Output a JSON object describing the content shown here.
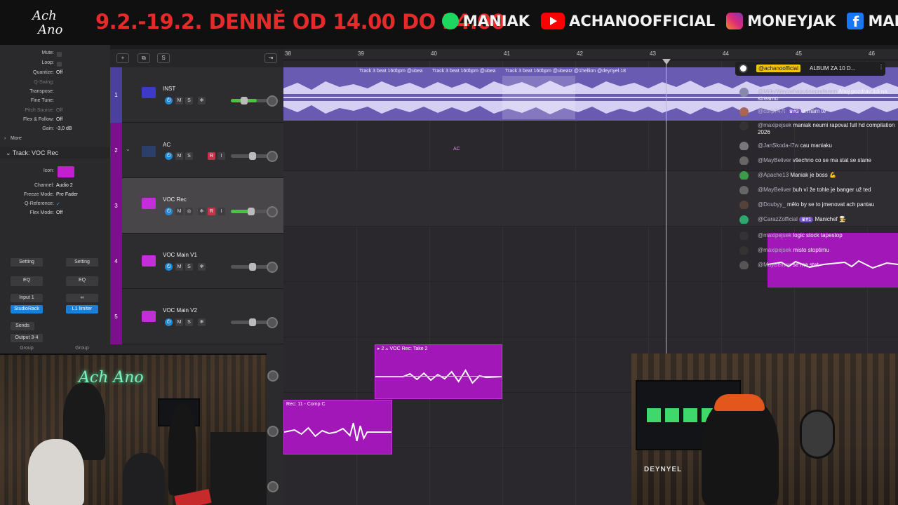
{
  "banner": {
    "logo_text": "ACH ANO",
    "promo_text": "9.2.-19.2. DENNĚ OD 14.00 DO 24.00",
    "socials": [
      {
        "icon": "spotify-icon",
        "label": "MANIAK"
      },
      {
        "icon": "youtube-icon",
        "label": "ACHANOOFFICIAL"
      },
      {
        "icon": "instagram-icon",
        "label": "MONEYJAK"
      },
      {
        "icon": "facebook-icon",
        "label": "MANIAKNAME"
      }
    ]
  },
  "inspector": {
    "mute_label": "Mute:",
    "loop_label": "Loop:",
    "quantize_label": "Quantize:",
    "quantize_value": "Off",
    "qswing_label": "Q-Swing:",
    "transpose_label": "Transpose:",
    "finetune_label": "Fine Tune:",
    "pitchsource_label": "Pitch Source:",
    "pitchsource_value": "Off",
    "flexfollow_label": "Flex & Follow:",
    "flexfollow_value": "Off",
    "gain_label": "Gain:",
    "gain_value": "-3,0 dB",
    "more_label": "More",
    "track_header": "Track:  VOC Rec",
    "icon_label": "Icon:",
    "channel_label": "Channel:",
    "channel_value": "Audio 2",
    "freeze_label": "Freeze Mode:",
    "freeze_value": "Pre Fader",
    "qref_label": "Q-Reference:",
    "qref_value": "✓",
    "flexmode_label": "Flex Mode:",
    "flexmode_value": "Off",
    "setting_left": "Setting",
    "setting_right": "Setting",
    "eq_left": "EQ",
    "eq_right": "EQ",
    "input_label": "Input 1",
    "plugin_left": "StudioRack",
    "plugin_right": "L1 limiter",
    "sends_label": "Sends",
    "output_label": "Output 3-4",
    "group_left": "Group",
    "group_right": "Group"
  },
  "toolbar": {
    "add": "+",
    "dup": "⧉",
    "s": "S"
  },
  "tracks": [
    {
      "num": "1",
      "name": "INST"
    },
    {
      "num": "2",
      "name": "AC"
    },
    {
      "num": "3",
      "name": "VOC Rec"
    },
    {
      "num": "4",
      "name": "VOC Main V1"
    },
    {
      "num": "5",
      "name": "VOC Main V2"
    }
  ],
  "button_labels": {
    "mute": "M",
    "solo": "S",
    "record": "R",
    "input": "I"
  },
  "ruler": {
    "bars": [
      "38",
      "39",
      "40",
      "41",
      "42",
      "43",
      "44",
      "45",
      "46"
    ]
  },
  "regions": {
    "inst_1": "Track 3 beat 160bpm @ubea",
    "inst_2": "Track 3 beat 160bpm @ubea",
    "inst_3": "Track 3 beat 160bpm @ubeatz @1hellion @deynyel.18",
    "ac_label": "AC",
    "voc_take": "▸ 2  ⟑ VOC Rec: Take 2",
    "voc_comp": "Rec: 11 - Comp C"
  },
  "chat": {
    "pinned_name": "@achanoofficial",
    "pinned_msg": "ALBUM ZA 10 D...",
    "lines": [
      {
        "name": "@MilkyWayzehaputinepreferem",
        "msg": "Ahoj pozdrav lidi na streamu"
      },
      {
        "name": "@corp747t",
        "badge": "#3",
        "msg": "a mam te"
      },
      {
        "name": "@maxipejsek",
        "msg": "maniak neumi rapovat full hd compilation 2026"
      },
      {
        "name": "@JanSkoda-l7w",
        "msg": "cau maniaku"
      },
      {
        "name": "@MayBeliver",
        "msg": "všechno co se ma stat se stane"
      },
      {
        "name": "@Apache13",
        "msg": "Maniak je boss 💪"
      },
      {
        "name": "@MayBeliver",
        "msg": "buh ví že tohle je banger už ted"
      },
      {
        "name": "@Doubyy_",
        "msg": "mělo by se to jmenovat ach pantau"
      },
      {
        "name": "@CarazZofficial",
        "badge": "#1",
        "msg": "Manichef 👨‍🍳"
      },
      {
        "name": "@maxipejsek",
        "msg": "logic stock tapestop"
      },
      {
        "name": "@maxipejsek",
        "msg": "misto stoptimu"
      },
      {
        "name": "@MayBeliver",
        "msg": "se ma stat"
      }
    ]
  },
  "cams": {
    "neon_text": "Ach Ano",
    "shirt_text": "DEYNYEL"
  },
  "colors": {
    "voc": "#a117b8",
    "inst": "#6a5bb2",
    "banner_red": "#e52a2a",
    "chat_highlight": "#f1c40f"
  }
}
